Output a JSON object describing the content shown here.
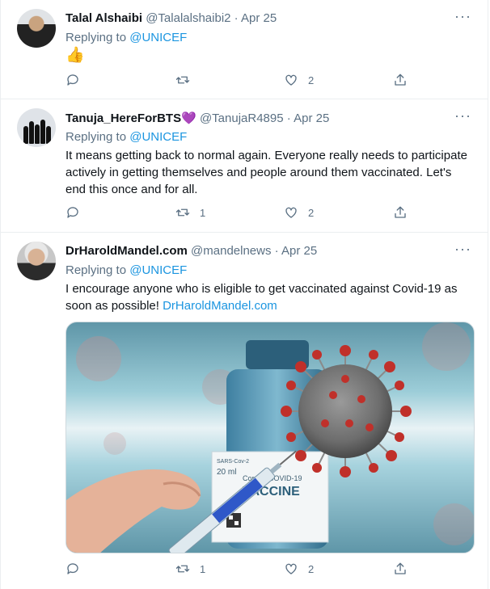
{
  "tweets": [
    {
      "name": "Talal Alshaibi",
      "handle": "@Talalalshaibi2",
      "date": "· Apr 25",
      "replying_prefix": "Replying to",
      "replying_to": "@UNICEF",
      "text": "👍",
      "reply_count": "",
      "retweet_count": "",
      "like_count": "2"
    },
    {
      "name": "Tanuja_HereForBTS",
      "name_emoji": "💜",
      "handle": "@TanujaR4895",
      "date": "· Apr 25",
      "replying_prefix": "Replying to",
      "replying_to": "@UNICEF",
      "text": "It means getting back to normal again. Everyone really needs to participate actively in getting themselves and people around them vaccinated. Let's end this once and for all.",
      "reply_count": "",
      "retweet_count": "1",
      "like_count": "2"
    },
    {
      "name": "DrHaroldMandel.com",
      "handle": "@mandelnews",
      "date": "· Apr 25",
      "replying_prefix": "Replying to",
      "replying_to": "@UNICEF",
      "text": "I encourage anyone who is eligible to get vaccinated against Covid-19 as soon as possible!",
      "link": "DrHaroldMandel.com",
      "media": {
        "vial_label_top": "SARS-Cov-2",
        "vial_volume": "20 ml",
        "vial_label_main": "Corona COVID-19",
        "vial_label_big": "VACCINE"
      },
      "reply_count": "",
      "retweet_count": "1",
      "like_count": "2"
    }
  ],
  "more_glyph": "···",
  "colors": {
    "link": "#1b95e0",
    "muted": "#5b7083",
    "divider": "#ebeef0"
  },
  "icons": [
    "reply-icon",
    "retweet-icon",
    "like-icon",
    "share-icon",
    "more-icon"
  ]
}
